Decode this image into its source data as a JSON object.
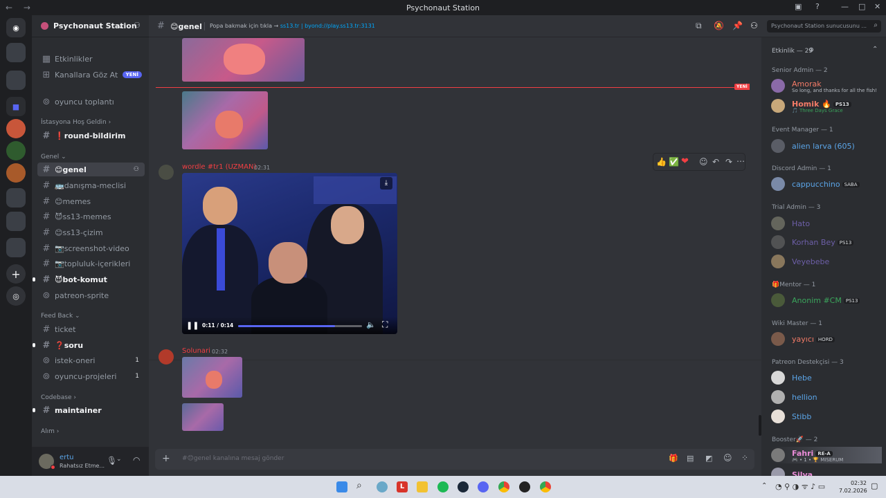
{
  "window": {
    "title": "Psychonaut Station"
  },
  "server": {
    "name": "Psychonaut Station"
  },
  "sidebar": {
    "top_items": [
      {
        "label": "Etkinlikler"
      },
      {
        "label": "Kanallara Göz At",
        "badge": "YENİ"
      }
    ],
    "voice": "oyuncu toplantı",
    "categories": [
      "İstasyona Hoş Geldin",
      "Genel",
      "Feed Back",
      "Codebase",
      "Alım"
    ],
    "channels": {
      "round": "❗round-bildirim",
      "genel": "😊genel",
      "danisma": "🚌danışma-meclisi",
      "memes": "😊memes",
      "ss13memes": "😈ss13-memes",
      "cizim": "😊ss13-çizim",
      "screenshot": "📷screenshot-video",
      "topluluk": "📷topluluk-içerikleri",
      "bot": "😈bot-komut",
      "patreon": "patreon-sprite",
      "ticket": "ticket",
      "soru": "❓soru",
      "istek": "istek-oneri",
      "istek_count": "1",
      "oyuncu": "oyuncu-projeleri",
      "oyuncu_count": "1",
      "maintainer": "maintainer"
    }
  },
  "user": {
    "name": "ertu",
    "status": "Rahatsız Etme..."
  },
  "channel_header": {
    "name": "😊genel",
    "topic": "Popa bakmak için tıkla → ",
    "topic_link": "ss13.tr | byond://play.ss13.tr:3131",
    "search_placeholder": "Psychonaut Station sunucusunu ..."
  },
  "messages": {
    "new_marker": "YENİ",
    "m1": {
      "author": "wordle #tr1 (UZMAN)",
      "time": "02:31"
    },
    "video": {
      "time": "0:11 / 0:14",
      "progress": 0.78
    },
    "m2": {
      "author": "Solunari",
      "time": "02:32"
    },
    "reactions": [
      "👍",
      "✅",
      "❤"
    ]
  },
  "composer": {
    "placeholder": "#😊genel kanalına mesaj gönder"
  },
  "members": {
    "header": "Etkinlik — 29",
    "roles": [
      {
        "name": "Senior Admin — 2"
      },
      {
        "name": "Event Manager — 1"
      },
      {
        "name": "Discord Admin — 1"
      },
      {
        "name": "Trial Admin — 3"
      },
      {
        "name": "🎁Mentor — 1"
      },
      {
        "name": "Wiki Master — 1"
      },
      {
        "name": "Patreon Destekçisi — 3"
      },
      {
        "name": "Booster🚀 — 2"
      }
    ],
    "list": [
      {
        "name": "Amorak",
        "sub": "So long, and thanks for all the fish!",
        "color": "#f47b67"
      },
      {
        "name": "Homik 🔥",
        "tag": "PS13",
        "sub": "🎵 Three Days Grace",
        "color": "#f47b67"
      },
      {
        "name": "alien larva (605)",
        "color": "#5ba5e8"
      },
      {
        "name": "cappucchino",
        "tag": "SABA",
        "color": "#5ba5e8"
      },
      {
        "name": "Hato",
        "color": "#6d5fa8"
      },
      {
        "name": "Korhan Bey",
        "tag": "PS13",
        "color": "#6d5fa8"
      },
      {
        "name": "Veyebebe",
        "color": "#6d5fa8"
      },
      {
        "name": "Anonim #CM",
        "tag": "PS13",
        "color": "#3ba55c"
      },
      {
        "name": "yayıcı",
        "tag": "HORD",
        "color": "#f47b67"
      },
      {
        "name": "Hebe",
        "color": "#5ba5e8"
      },
      {
        "name": "hellion",
        "color": "#5ba5e8"
      },
      {
        "name": "Stibb",
        "color": "#5ba5e8"
      },
      {
        "name": "Fahri",
        "tag": "RE-A",
        "sub": "🎮 • 1 • 🏆 MISERUM",
        "color": "#e88bd6"
      },
      {
        "name": "Silva",
        "color": "#e88bd6"
      }
    ]
  },
  "taskbar": {
    "time": "02:32",
    "date": "7.02.2026"
  }
}
